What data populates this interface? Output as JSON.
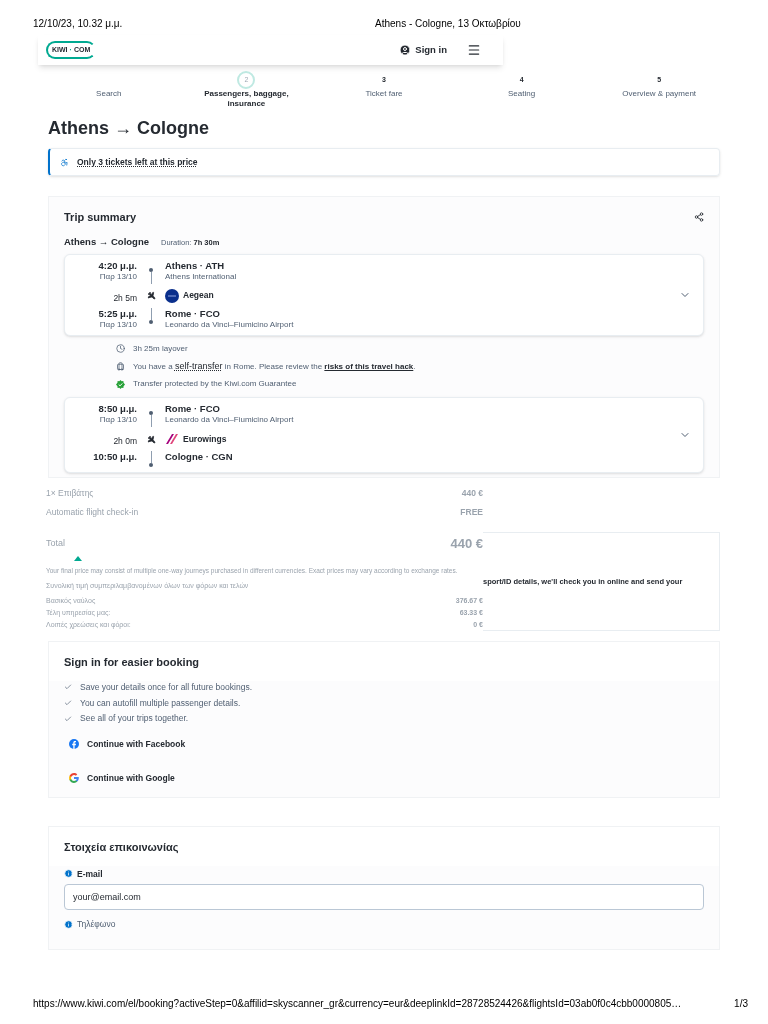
{
  "print_header": {
    "date": "12/10/23, 10.32 μ.μ.",
    "title": "Athens - Cologne, 13 Οκτωβρίου"
  },
  "header": {
    "logo_left": "KIWI",
    "logo_dot": "·",
    "logo_right": "COM",
    "sign_in": "Sign in"
  },
  "steps": [
    {
      "label": "Search",
      "selected": false
    },
    {
      "number": "2",
      "label": "Passengers, baggage, insurance",
      "selected": true
    },
    {
      "number": "3",
      "label": "Ticket fare",
      "selected": false
    },
    {
      "number": "4",
      "label": "Seating",
      "selected": false
    },
    {
      "number": "5",
      "label": "Overview & payment",
      "selected": false
    }
  ],
  "title": "Athens → Cologne",
  "alert": "Only 3 tickets left at this price",
  "trip_summary": {
    "title": "Trip summary",
    "route": "Athens → Cologne",
    "duration_label": "Duration:",
    "duration": "7h 30m",
    "segments": [
      {
        "depart_time": "4:20 μ.μ.",
        "depart_date": "Παρ 13/10",
        "depart_place": "Athens · ATH",
        "depart_airport": "Athens International",
        "flight_time": "2h 5m",
        "airline": {
          "kind": "aegean",
          "name": "Aegean"
        },
        "arrive_time": "5:25 μ.μ.",
        "arrive_date": "Παρ 13/10",
        "arrive_place": "Rome · FCO",
        "arrive_airport": "Leonardo da Vinci–Fiumicino Airport"
      },
      {
        "depart_time": "8:50 μ.μ.",
        "depart_date": "Παρ 13/10",
        "depart_place": "Rome · FCO",
        "depart_airport": "Leonardo da Vinci–Fiumicino Airport",
        "flight_time": "2h 0m",
        "airline": {
          "kind": "eurowings",
          "name": "Eurowings"
        },
        "arrive_time": "10:50 μ.μ.",
        "arrive_place": "Cologne · CGN"
      }
    ],
    "layover": [
      {
        "kind": "layover",
        "text": "3h 25m layover"
      },
      {
        "kind": "self_transfer",
        "before": "You have a",
        "term": "self-transfer",
        "middle": "in Rome. Please review the",
        "link": "risks of this travel hack",
        "after": "."
      },
      {
        "kind": "guarantee",
        "text": "Transfer protected by the Kiwi.com Guarantee"
      }
    ]
  },
  "price": {
    "rows": [
      {
        "label": "1× Επιβάτης",
        "value": "440 €"
      },
      {
        "label": "Automatic flight check-in",
        "value": "FREE"
      }
    ],
    "total_label": "Total",
    "total": "440 €",
    "note": "Your final price may consist of multiple one-way journeys purchased in different currencies. Exact prices may vary according to exchange rates.",
    "tax_note": "Συνολική τιμή συμπεριλαμβανομένων όλων των φόρων και τελών",
    "breakdown": [
      {
        "label": "Βασικός ναύλος",
        "value": "376.67 €"
      },
      {
        "label": "Τέλη υπηρεσίας μας:",
        "value": "63.33 €"
      },
      {
        "label": "Λοιπές χρεώσεις και φόροι:",
        "value": "0 €"
      }
    ]
  },
  "checkin_card": {
    "text": "sport/ID details, we'll check you in online and send your"
  },
  "sign_in": {
    "title": "Sign in for easier booking",
    "benefits": [
      "Save your details once for all future bookings.",
      "You can autofill multiple passenger details.",
      "See all of your trips together."
    ],
    "buttons": [
      {
        "kind": "facebook",
        "label": "Continue with Facebook"
      },
      {
        "kind": "google",
        "label": "Continue with Google"
      }
    ]
  },
  "contact": {
    "title": "Στοιχεία επικοινωνίας",
    "email_label": "E-mail",
    "email_placeholder": "your@email.com",
    "phone_label": "Τηλέφωνο"
  },
  "print_footer": {
    "url": "https://www.kiwi.com/el/booking?activeStep=0&affilid=skyscanner_gr&currency=eur&deeplinkId=28728524426&flightsId=03ab0f0c4cbb0000805…",
    "page": "1/3"
  }
}
